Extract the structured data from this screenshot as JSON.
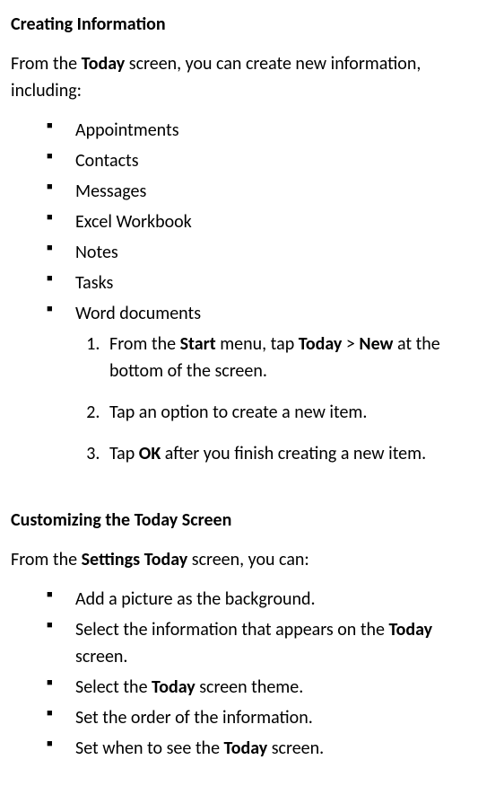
{
  "section1": {
    "heading": "Creating Information",
    "intro_pre": "From the ",
    "intro_bold": "Today",
    "intro_post": " screen, you can create new information, including:",
    "bullets": [
      "Appointments",
      "Contacts",
      "Messages",
      "Excel Workbook",
      "Notes",
      "Tasks",
      "Word documents"
    ],
    "steps": {
      "s1_a": "From the ",
      "s1_b": "Start",
      "s1_c": " menu, tap ",
      "s1_d": "Today",
      "s1_e": " > ",
      "s1_f": "New",
      "s1_g": " at the bottom of the screen.",
      "s2": "Tap an option to create a new item.",
      "s3_a": "Tap ",
      "s3_b": "OK",
      "s3_c": " after you finish creating a new item."
    }
  },
  "section2": {
    "heading": "Customizing the Today Screen",
    "intro_pre": "From the ",
    "intro_bold": "Settings Today",
    "intro_post": " screen, you can:",
    "bullets": {
      "b1": "Add a picture as the background.",
      "b2_a": "Select the information that appears on the ",
      "b2_b": "Today",
      "b2_c": " screen.",
      "b3_a": "Select the ",
      "b3_b": "Today",
      "b3_c": " screen theme.",
      "b4": "Set the order of the information.",
      "b5_a": "Set when to see the ",
      "b5_b": "Today",
      "b5_c": " screen."
    }
  }
}
